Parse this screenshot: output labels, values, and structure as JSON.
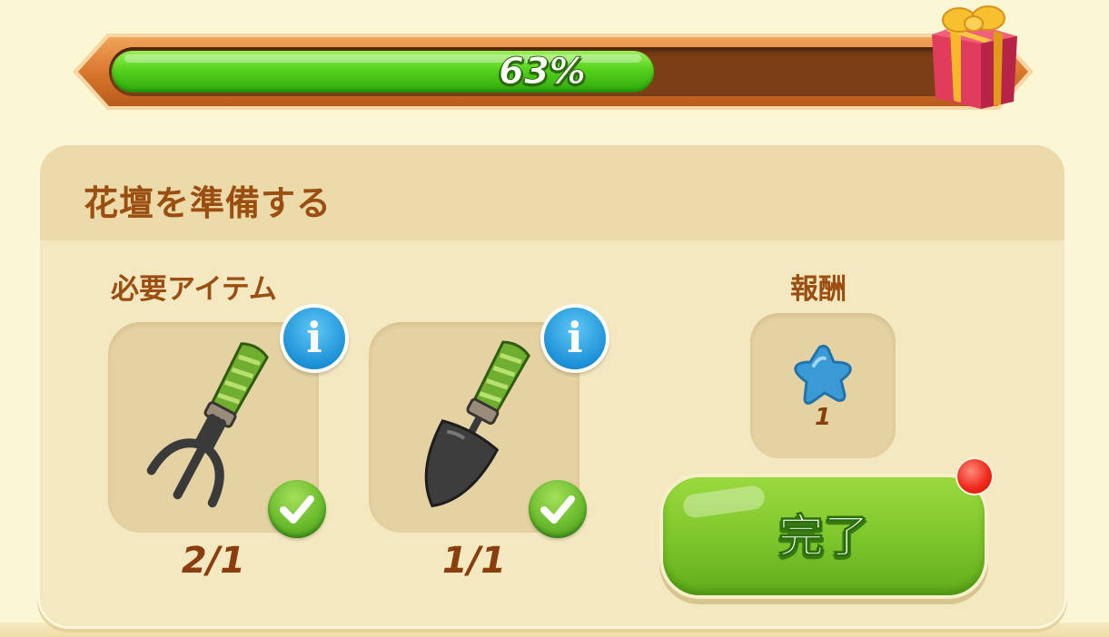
{
  "progress": {
    "percent_text": "63%",
    "value_fraction": 0.63,
    "reward_icon": "gift-box-icon"
  },
  "task": {
    "title": "花壇を準備する",
    "required_label": "必要アイテム",
    "items": [
      {
        "icon": "garden-fork-icon",
        "count": "2/1",
        "completed": true
      },
      {
        "icon": "garden-trowel-icon",
        "count": "1/1",
        "completed": true
      }
    ],
    "reward_label": "報酬",
    "reward": {
      "icon": "blue-star-icon",
      "count": "1"
    },
    "complete_button": "完了"
  },
  "colors": {
    "background": "#fbf6d3",
    "title_brown": "#9a4e12",
    "progress_green": "#55d21c",
    "button_green": "#82c92e",
    "info_blue": "#1d92d8",
    "notification_red": "#ef2b1d"
  }
}
